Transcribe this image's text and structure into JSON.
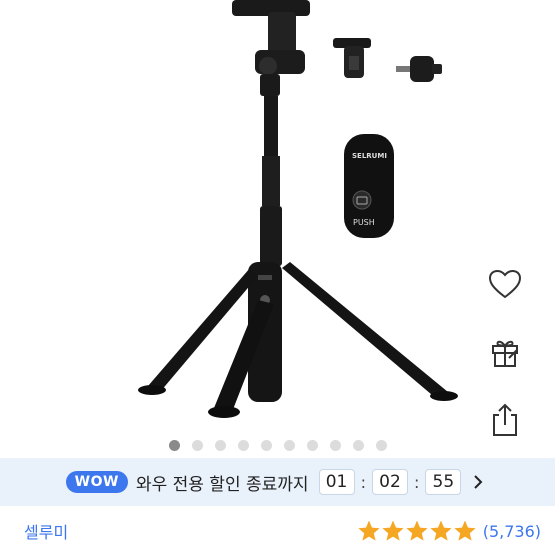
{
  "colors": {
    "accent": "#3d77ee",
    "star": "#f5a623",
    "wow_bg": "#e9f1fb"
  },
  "product_image": {
    "icon": "selfie-stick-tripod-image",
    "remote_label_brand": "SELRUMI",
    "remote_label_button": "PUSH"
  },
  "side_actions": [
    {
      "icon": "heart-icon"
    },
    {
      "icon": "gift-icon"
    },
    {
      "icon": "share-icon"
    }
  ],
  "carousel": {
    "total": 10,
    "active": 1
  },
  "wow": {
    "badge": "WOW",
    "text": "와우 전용 할인 종료까지",
    "hours": "01",
    "minutes": "02",
    "seconds": "55",
    "separator": ":"
  },
  "product": {
    "seller": "셀루미",
    "rating": 5,
    "review_count": "(5,736)"
  }
}
